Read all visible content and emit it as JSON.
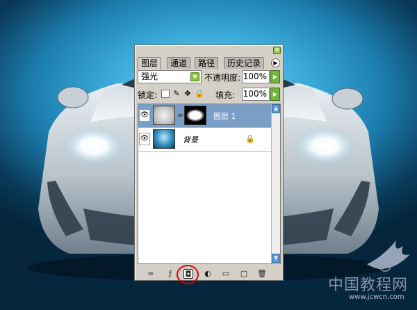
{
  "panel": {
    "tabs": [
      "图层",
      "通道",
      "路径",
      "历史记录"
    ],
    "blend_mode": "强光",
    "opacity_label": "不透明度:",
    "opacity_value": "100%",
    "lock_label": "锁定:",
    "fill_label": "填充:",
    "fill_value": "100%",
    "layers": [
      {
        "name": "图层 1",
        "selected": true,
        "visible": true,
        "has_mask": true,
        "locked": false
      },
      {
        "name": "背景",
        "selected": false,
        "visible": true,
        "has_mask": false,
        "locked": true
      }
    ],
    "bottom_tools": [
      "link-layers-icon",
      "layer-style-icon",
      "add-mask-icon",
      "adjustment-layer-icon",
      "new-group-icon",
      "new-layer-icon",
      "delete-layer-icon"
    ]
  },
  "highlight": {
    "target": "add-mask-button",
    "color": "#e00000"
  },
  "watermark": {
    "brand": "中国教程网",
    "url": "www.jcwcn.com"
  },
  "colors": {
    "panel_bg": "#d4d0c8",
    "selected_layer": "#7a9ec6",
    "accent_green": "#89c23e",
    "background_blue": "#3aa9d9"
  }
}
